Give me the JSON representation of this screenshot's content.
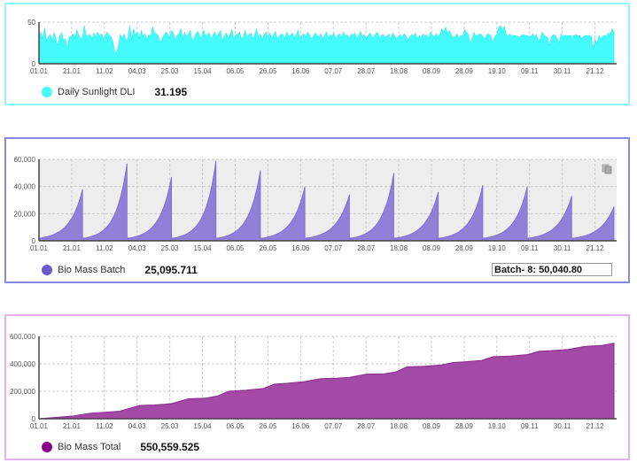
{
  "charts": [
    {
      "id": "dli",
      "legend_label": "Daily Sunlight DLI",
      "legend_value": "31.195",
      "color": "#44fafa",
      "border_color": "#8ff8f8"
    },
    {
      "id": "batch",
      "legend_label": "Bio Mass Batch",
      "legend_value": "25,095.711",
      "color": "#7b68d6",
      "border_color": "#8888f0",
      "tooltip": "Batch- 8: 50,040.80",
      "copy_icon": "copy-icon"
    },
    {
      "id": "total",
      "legend_label": "Bio Mass Total",
      "legend_value": "550,559.525",
      "color": "#9b3b9e",
      "border_color": "#e2b0ee"
    }
  ],
  "chart_data": [
    {
      "type": "area",
      "title": "",
      "series": [
        {
          "name": "Daily Sunlight DLI",
          "summary_value": 31.195,
          "values": [
            32,
            38,
            30,
            43,
            28,
            33,
            35,
            27,
            38,
            30,
            22,
            34,
            37,
            28,
            30,
            18,
            33,
            32,
            36,
            30,
            41,
            35,
            29,
            33,
            46,
            33,
            34,
            35,
            30,
            37,
            32,
            38,
            33,
            36,
            30,
            34,
            38,
            34,
            33,
            27,
            16,
            12,
            22,
            35,
            31,
            36,
            28,
            30,
            46,
            29,
            42,
            35,
            38,
            31,
            40,
            33,
            36,
            29,
            35,
            33,
            44,
            38,
            36,
            34,
            26,
            30,
            34,
            38,
            36,
            31,
            40,
            37,
            29,
            34,
            36,
            42,
            30,
            38,
            33,
            35,
            40,
            28,
            31,
            36,
            39,
            34,
            30,
            41,
            33,
            35,
            37,
            30,
            34,
            38,
            32,
            36,
            40,
            27,
            33,
            37,
            31,
            35,
            41,
            30,
            34,
            36,
            38,
            29,
            33,
            40,
            31,
            35,
            37,
            30,
            34,
            42,
            33,
            36,
            29,
            35,
            38,
            32,
            37,
            31,
            34,
            39,
            30,
            33,
            36,
            35,
            30,
            38,
            33,
            34,
            37,
            31,
            35,
            40,
            29,
            34,
            36,
            32,
            38,
            35,
            30,
            33,
            37,
            34,
            32,
            36,
            30,
            34,
            38,
            31,
            35,
            33,
            37,
            30,
            34,
            36,
            32,
            38,
            33,
            35,
            30,
            36,
            34,
            37,
            31,
            33,
            39,
            32,
            35,
            30,
            34,
            37,
            33,
            31,
            36,
            38,
            30,
            34,
            35,
            32,
            33,
            36,
            29,
            37,
            34,
            30,
            33,
            35,
            31,
            36,
            34,
            28,
            32,
            35,
            33,
            37,
            30,
            34,
            31,
            36,
            33,
            35,
            30,
            38,
            34,
            32,
            36,
            33,
            35,
            42,
            38,
            44,
            36,
            40,
            35,
            31,
            33,
            36,
            30,
            34,
            33,
            41,
            38,
            35,
            25,
            30,
            38,
            33,
            34,
            36,
            35,
            32,
            30,
            36,
            35,
            34,
            25,
            33,
            35,
            43,
            46,
            40,
            45,
            35,
            33,
            36,
            33,
            34,
            34,
            33,
            32,
            34,
            35,
            34,
            34,
            33,
            33,
            36,
            32,
            35,
            28,
            30,
            38,
            34,
            33,
            31,
            22,
            33,
            35,
            34,
            30,
            25,
            36,
            33,
            34,
            34,
            34,
            34,
            33,
            34,
            35,
            33,
            34,
            30,
            33,
            34,
            34,
            34,
            33,
            17,
            30,
            24,
            34,
            30,
            33,
            34,
            33,
            37,
            35,
            42,
            38
          ]
        }
      ],
      "x_tick_labels": [
        "01.01",
        "21.01",
        "11.02",
        "04.03",
        "25.03",
        "15.04",
        "06.05",
        "26.05",
        "16.06",
        "07.07",
        "28.07",
        "18.08",
        "08.09",
        "28.09",
        "19.10",
        "09.11",
        "30.11",
        "21.12"
      ],
      "y_tick_labels": [
        "0",
        "50"
      ],
      "ylim": [
        0,
        50
      ],
      "xlabel": "",
      "ylabel": "",
      "grid": true,
      "legend": "bottom-left"
    },
    {
      "type": "area",
      "title": "",
      "series": [
        {
          "name": "Bio Mass Batch",
          "summary_value": 25095.711,
          "batch_peaks": [
            38000,
            57000,
            47000,
            59000,
            52000,
            40000,
            34000,
            50040.8,
            36000,
            41000,
            40000,
            33000,
            25095.711
          ],
          "batch_start_value": 2000
        }
      ],
      "x_tick_labels": [
        "01.01",
        "21.01",
        "11.02",
        "04.03",
        "25.03",
        "15.04",
        "06.05",
        "26.05",
        "16.06",
        "07.07",
        "28.07",
        "18.08",
        "08.09",
        "28.09",
        "19.10",
        "09.11",
        "30.11",
        "21.12"
      ],
      "y_tick_labels": [
        "0",
        "20,000",
        "40,000",
        "60,000"
      ],
      "ylim": [
        0,
        60000
      ],
      "xlabel": "",
      "ylabel": "",
      "grid": true,
      "legend": "bottom-left",
      "annotation": "Batch- 8: 50,040.80"
    },
    {
      "type": "area",
      "title": "",
      "series": [
        {
          "name": "Bio Mass Total",
          "summary_value": 550559.525,
          "x_fraction": [
            0,
            0.06,
            0.09,
            0.11,
            0.14,
            0.175,
            0.2,
            0.23,
            0.26,
            0.29,
            0.31,
            0.33,
            0.36,
            0.39,
            0.41,
            0.43,
            0.46,
            0.49,
            0.52,
            0.54,
            0.57,
            0.6,
            0.62,
            0.64,
            0.67,
            0.7,
            0.72,
            0.74,
            0.77,
            0.79,
            0.82,
            0.85,
            0.87,
            0.89,
            0.92,
            0.95,
            0.98,
            1.0
          ],
          "values": [
            0,
            20000,
            40000,
            45000,
            55000,
            97000,
            100000,
            110000,
            145000,
            150000,
            165000,
            200000,
            208000,
            220000,
            252000,
            258000,
            270000,
            292000,
            296000,
            302000,
            325000,
            328000,
            340000,
            378000,
            382000,
            392000,
            410000,
            415000,
            425000,
            452000,
            457000,
            468000,
            492000,
            496000,
            505000,
            528000,
            535000,
            550559.525
          ]
        }
      ],
      "x_tick_labels": [
        "01.01",
        "21.01",
        "11.02",
        "04.03",
        "25.03",
        "15.04",
        "06.05",
        "26.05",
        "16.06",
        "07.07",
        "28.07",
        "18.08",
        "08.09",
        "28.09",
        "19.10",
        "09.11",
        "30.11",
        "21.12"
      ],
      "y_tick_labels": [
        "0",
        "200,000",
        "400,000",
        "600,000"
      ],
      "ylim": [
        0,
        600000
      ],
      "xlabel": "",
      "ylabel": "",
      "grid": true,
      "legend": "bottom-left"
    }
  ]
}
